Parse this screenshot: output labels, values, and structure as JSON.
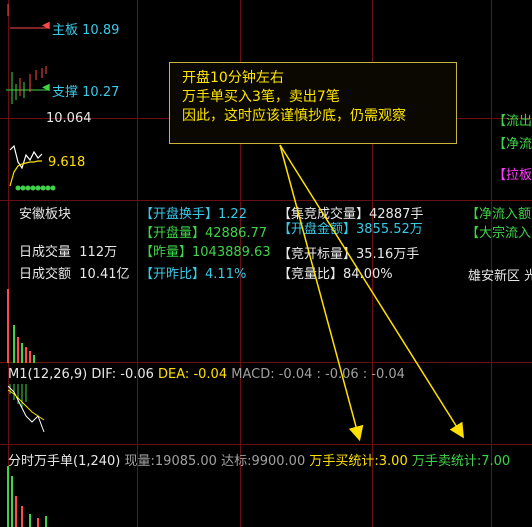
{
  "price_levels": {
    "main_label": "主板",
    "main_value": "10.89",
    "support_label": "支撑",
    "support_value": "10.27",
    "price_mid": "10.064",
    "price_low": "9.618"
  },
  "tooltip": {
    "line1": "开盘10分钟左右",
    "line2": "万手单买入3笔，卖出7笔",
    "line3": "因此，这时应该谨慎抄底，仍需观察"
  },
  "right_side": {
    "item1": "【流出",
    "item2": "【净流",
    "item3": "【拉板"
  },
  "stats": {
    "sector": "安徽板块",
    "daily_volume_label": "日成交量",
    "daily_volume_value": "112万",
    "daily_amount_label": "日成交额",
    "daily_amount_value": "10.41亿",
    "open_turnover_label": "【开盘换手】",
    "open_turnover_value": "1.22",
    "open_volume_label": "【开盘量】",
    "open_volume_value": "42886.77",
    "yesterday_volume_label": "【昨量】",
    "yesterday_volume_value": "1043889.63",
    "open_ratio_label": "【开昨比】",
    "open_ratio_value": "4.11%",
    "auction_volume_label": "【集竞成交量】",
    "auction_volume_value": "42887手",
    "open_amount_label": "【开盘金额】",
    "open_amount_value": "3855.52万",
    "auction_target_label": "【竞开标量】",
    "auction_target_value": "35.16万手",
    "quantity_ratio_label": "【竞量比】",
    "quantity_ratio_value": "84.00%",
    "net_inflow_label": "【净流入额】",
    "block_inflow_label": "【大宗流入】",
    "concept": "雄安新区 光"
  },
  "macd": {
    "title": "M1(12,26,9)",
    "dif_label": "DIF:",
    "dif_value": "-0.06",
    "dea_label": "DEA:",
    "dea_value": "-0.04",
    "macd_label": "MACD:",
    "macd_value": "-0.04 : -0.06 : -0.04"
  },
  "orders": {
    "title": "分时万手单(1,240)",
    "now_label": "现量:",
    "now_value": "19085.00",
    "target_label": "达标:",
    "target_value": "9900.00",
    "buy_label": "万手买统计:",
    "buy_value": "3.00",
    "sell_label": "万手卖统计:",
    "sell_value": "7.00"
  },
  "colors": {
    "background": "#000000",
    "grid": "#6b1010",
    "annotation": "#ffe000",
    "inflow": "#3fd34a",
    "label": "#3ac9e6"
  }
}
